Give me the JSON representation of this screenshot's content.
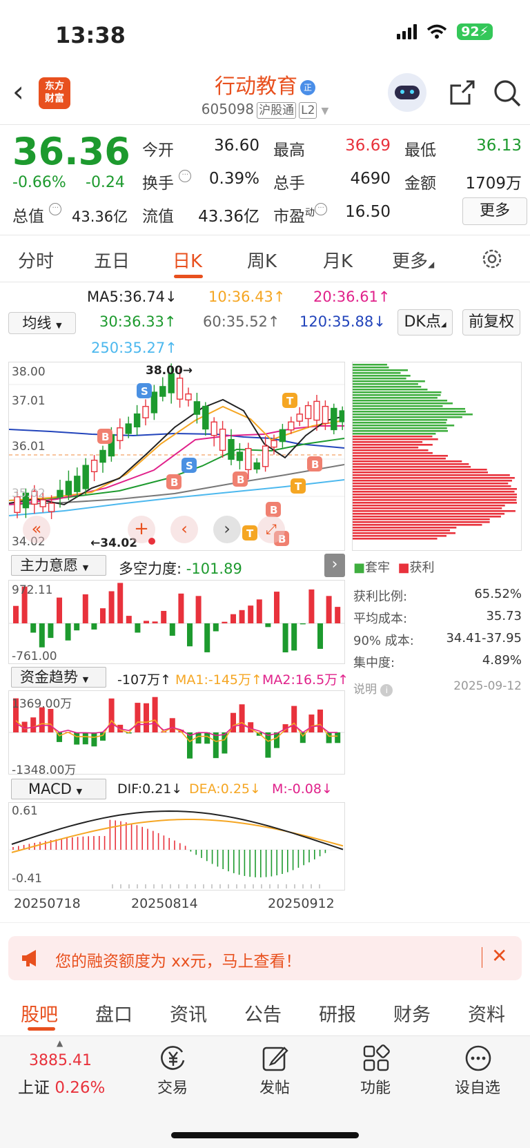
{
  "status": {
    "time": "13:38",
    "battery": "92"
  },
  "header": {
    "back": "‹",
    "logo": "东方\n财富",
    "logo_l1": "东方",
    "logo_l2": "财富",
    "name": "行动教育",
    "name_badge": "正",
    "code": "605098",
    "exchange_tag": "沪股通",
    "level_tag": "L2"
  },
  "quote": {
    "price": "36.36",
    "change_pct": "-0.66%",
    "change_abs": "-0.24",
    "open_label": "今开",
    "open": "36.60",
    "high_label": "最高",
    "high": "36.69",
    "low_label": "最低",
    "low": "36.13",
    "turnover_label": "换手",
    "turnover": "0.39%",
    "volume_label": "总手",
    "volume": "4690",
    "amount_label": "金额",
    "amount": "1709万",
    "mktcap_label": "总值",
    "mktcap": "43.36亿",
    "float_label": "流值",
    "float": "43.36亿",
    "pe_label": "市盈",
    "pe_sup": "动",
    "pe": "16.50",
    "more": "更多"
  },
  "period_tabs": [
    "分时",
    "五日",
    "日K",
    "周K",
    "月K",
    "更多"
  ],
  "ma": {
    "line_type": "均线",
    "ma5": "MA5:36.74",
    "ma10": "10:36.43",
    "ma20": "20:36.61",
    "ma30": "30:36.33",
    "ma60": "60:35.52",
    "ma120": "120:35.88",
    "ma250": "250:35.27",
    "dk": "DK点",
    "adjust": "前复权",
    "colors": {
      "ma5": "#222222",
      "ma10": "#f5a623",
      "ma20": "#e0218a",
      "ma30": "#1d9a2e",
      "ma60": "#777777",
      "ma120": "#2244bb",
      "ma250": "#4cb8ee"
    }
  },
  "kline": {
    "y_top": "38.00",
    "y_2": "37.01",
    "y_3": "36.01",
    "y_4": "35.02",
    "y_bottom": "34.02",
    "high_mark": "38.00",
    "low_mark": "34.02",
    "markers": {
      "s": "S",
      "b": "B",
      "t": "T"
    }
  },
  "chips": {
    "legend_trapped": "套牢",
    "legend_profit": "获利",
    "rows": [
      {
        "label": "获利比例:",
        "value": "65.52%"
      },
      {
        "label": "平均成本:",
        "value": "35.73"
      },
      {
        "label": "90% 成本:",
        "value": "34.41-37.95"
      },
      {
        "label": "集中度:",
        "value": "4.89%"
      }
    ],
    "note": "说明",
    "date": "2025-09-12"
  },
  "zlyy": {
    "selector": "主力意愿",
    "label": "多空力度:",
    "value": "-101.89",
    "y_top": "972.11",
    "y_bottom": "-761.00"
  },
  "zjqs": {
    "selector": "资金趋势",
    "value": "-107万",
    "ma1": "MA1:-145万",
    "ma2": "MA2:16.5万",
    "y_top": "1369.00万",
    "y_bottom": "-1348.00万"
  },
  "macd": {
    "selector": "MACD",
    "dif": "DIF:0.21",
    "dea": "DEA:0.25",
    "m": "M:-0.08",
    "y_top": "0.61",
    "y_bottom": "-0.41",
    "dates": [
      "20250718",
      "20250814",
      "20250912"
    ]
  },
  "promo": {
    "text": "您的融资额度为 xx元，马上查看！"
  },
  "bottom_tabs": [
    "股吧",
    "盘口",
    "资讯",
    "公告",
    "研报",
    "财务",
    "资料"
  ],
  "bottom_nav": {
    "index_value": "3885.41",
    "index_name": "上证",
    "index_pct": "0.26%",
    "trade": "交易",
    "post": "发帖",
    "func": "功能",
    "watchlist": "设自选"
  }
}
